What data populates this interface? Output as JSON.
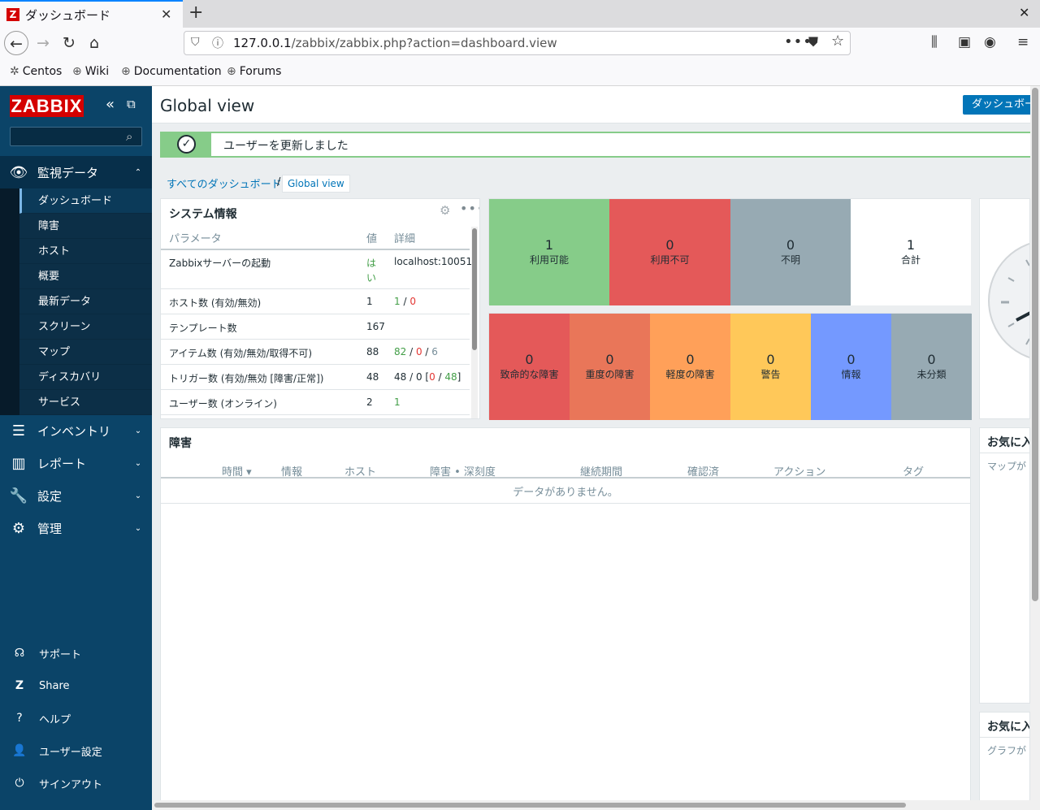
{
  "browser": {
    "tab_title": "ダッシュボード",
    "favicon_letter": "Z",
    "url_host": "127.0.0.1",
    "url_path": "/zabbix/zabbix.php?action=dashboard.view",
    "bookmarks": [
      "Centos",
      "Wiki",
      "Documentation",
      "Forums"
    ]
  },
  "sidebar": {
    "logo": "ZABBIX",
    "search_placeholder": "",
    "sections": [
      {
        "label": "監視データ",
        "icon": "eye-icon",
        "expanded": true
      },
      {
        "label": "インベントリ",
        "icon": "list-icon"
      },
      {
        "label": "レポート",
        "icon": "bar-chart-icon"
      },
      {
        "label": "設定",
        "icon": "wrench-icon"
      },
      {
        "label": "管理",
        "icon": "gear-icon"
      }
    ],
    "monitoring_items": [
      "ダッシュボード",
      "障害",
      "ホスト",
      "概要",
      "最新データ",
      "スクリーン",
      "マップ",
      "ディスカバリ",
      "サービス"
    ],
    "bottom_items": [
      {
        "label": "サポート",
        "icon": "headset-icon"
      },
      {
        "label": "Share",
        "icon": "share-z-icon"
      },
      {
        "label": "ヘルプ",
        "icon": "help-icon"
      },
      {
        "label": "ユーザー設定",
        "icon": "user-icon"
      },
      {
        "label": "サインアウト",
        "icon": "power-icon"
      }
    ]
  },
  "header": {
    "title": "Global view",
    "dashboard_button": "ダッシュボー"
  },
  "message": {
    "text": "ユーザーを更新しました"
  },
  "breadcrumb": {
    "all_dashboards": "すべてのダッシュボード",
    "separator": "/",
    "current": "Global view"
  },
  "system_info": {
    "title": "システム情報",
    "columns": [
      "パラメータ",
      "値",
      "詳細"
    ],
    "rows": [
      {
        "param": "Zabbixサーバーの起動",
        "value": "はい",
        "detail": "localhost:10051"
      },
      {
        "param": "ホスト数 (有効/無効)",
        "value": "1",
        "d1": "1",
        "s1": " / ",
        "d2": "0"
      },
      {
        "param": "テンプレート数",
        "value": "167"
      },
      {
        "param": "アイテム数 (有効/無効/取得不可)",
        "value": "88",
        "d1": "82",
        "s1": " / ",
        "d2": "0",
        "s2": " / ",
        "d3": "6"
      },
      {
        "param": "トリガー数 (有効/無効 [障害/正常])",
        "value": "48",
        "d0": "48 / 0 [",
        "d1": "0",
        "s1": " / ",
        "d2": "48",
        "s2": "]"
      },
      {
        "param": "ユーザー数 (オンライン)",
        "value": "2",
        "d1": "1"
      }
    ]
  },
  "host_availability": [
    {
      "value": "1",
      "label": "利用可能",
      "color": "#86cc89"
    },
    {
      "value": "0",
      "label": "利用不可",
      "color": "#e45959"
    },
    {
      "value": "0",
      "label": "不明",
      "color": "#97aab3"
    },
    {
      "value": "1",
      "label": "合計",
      "color": "#ffffff"
    }
  ],
  "problems_by_severity": [
    {
      "value": "0",
      "label": "致命的な障害",
      "color": "#e45959"
    },
    {
      "value": "0",
      "label": "重度の障害",
      "color": "#e97659"
    },
    {
      "value": "0",
      "label": "軽度の障害",
      "color": "#ffa059"
    },
    {
      "value": "0",
      "label": "警告",
      "color": "#ffc859"
    },
    {
      "value": "0",
      "label": "情報",
      "color": "#7499ff"
    },
    {
      "value": "0",
      "label": "未分類",
      "color": "#97aab3"
    }
  ],
  "problems": {
    "title": "障害",
    "columns": [
      "時間 ▾",
      "情報",
      "ホスト",
      "障害 • 深刻度",
      "継続期間",
      "確認済",
      "アクション",
      "タグ"
    ],
    "empty": "データがありません。"
  },
  "fav_maps": {
    "title": "お気に入",
    "sub": "マップが"
  },
  "fav_graphs": {
    "title": "お気に入",
    "sub": "グラフが"
  }
}
